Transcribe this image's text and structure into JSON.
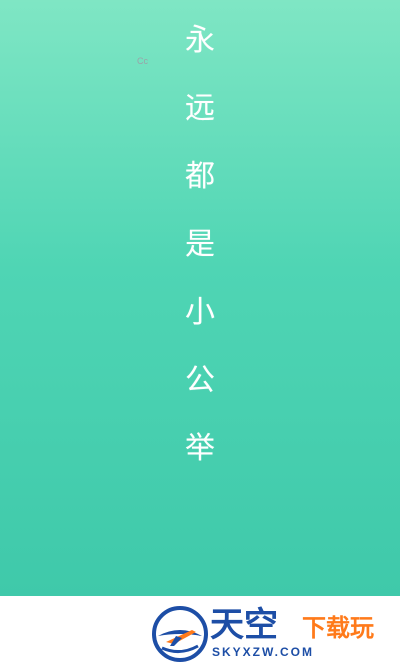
{
  "hero": {
    "characters": [
      "永",
      "远",
      "都",
      "是",
      "小",
      "公",
      "举"
    ]
  },
  "footer": {
    "left_text": "Cc",
    "brand_main": "天空",
    "brand_sub": "下载玩",
    "brand_domain": "SKYXZW.COM"
  },
  "colors": {
    "hero_top": "#7fe6c4",
    "hero_bottom": "#3fc9aa",
    "brand_blue": "#1d4ea6",
    "brand_orange": "#ff7a1a"
  }
}
